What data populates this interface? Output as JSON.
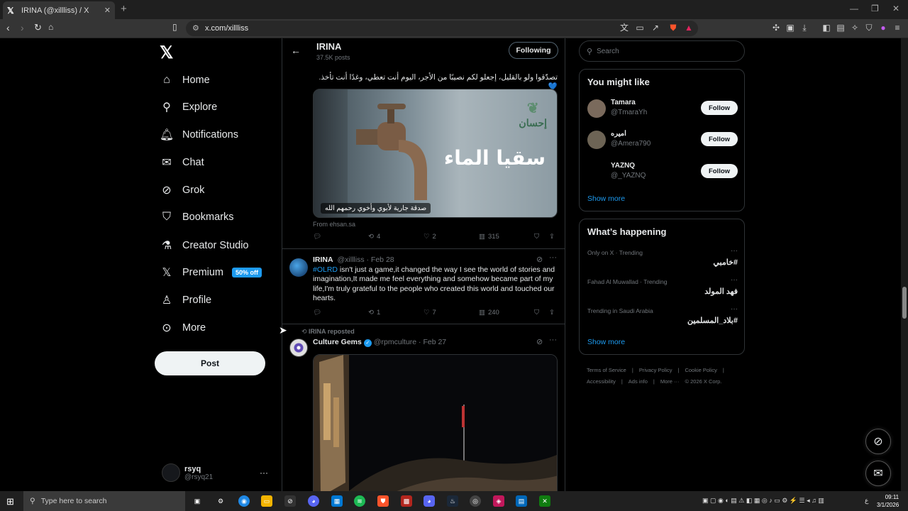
{
  "browser": {
    "tab_title": "IRINA (@xillliss) / X",
    "url": "x.com/xillliss",
    "new_tab": "+",
    "tab_close": "✕"
  },
  "nav": {
    "items": [
      {
        "label": "Home",
        "icon": "home-icon"
      },
      {
        "label": "Explore",
        "icon": "search-icon"
      },
      {
        "label": "Notifications",
        "icon": "bell-icon"
      },
      {
        "label": "Chat",
        "icon": "mail-icon"
      },
      {
        "label": "Grok",
        "icon": "grok-icon"
      },
      {
        "label": "Bookmarks",
        "icon": "bookmark-icon"
      },
      {
        "label": "Creator Studio",
        "icon": "flask-icon"
      },
      {
        "label": "Premium",
        "icon": "x-icon"
      },
      {
        "label": "Profile",
        "icon": "person-icon"
      },
      {
        "label": "More",
        "icon": "more-circle-icon"
      }
    ],
    "premium_badge": "50% off",
    "post_label": "Post",
    "user": {
      "name": "rsyq",
      "handle": "@rsyq21",
      "menu": "···"
    }
  },
  "header": {
    "name": "IRINA",
    "posts": "37.5K posts",
    "follow_label": "Following"
  },
  "tweet1": {
    "text": "تصدّقوا ولو بالقليل، إجعلو  لكم نصيبًا من الأجر، اليوم أنت تعطي، وغدًا أنت تأخذ.💙",
    "image_brand": "إحسان",
    "image_title": "سقيا الماء",
    "image_caption": "صدقة جارية لأبوي وأخوي رحمهم الله",
    "source": "From ehsan.sa",
    "reposts": "4",
    "likes": "2",
    "views": "315"
  },
  "tweet2": {
    "name": "IRINA",
    "handle": "@xillliss",
    "date": "· Feb 28",
    "tag": "#OLRD",
    "text": " isn't just a game,it changed the way I see the world of stories and imagination,It made me feel everything and somehow became part of my life,I'm truly grateful to the people who created this world and touched our hearts.",
    "reposts": "1",
    "likes": "7",
    "views": "240"
  },
  "tweet3": {
    "repost_label": "IRINA reposted",
    "name": "Culture Gems",
    "handle": "@rpmculture",
    "date": "· Feb 27"
  },
  "right": {
    "search_placeholder": "Search",
    "might_like_title": "You might like",
    "suggestions": [
      {
        "name": "Tamara",
        "handle": "@TmaraYh",
        "btn": "Follow"
      },
      {
        "name": "اميره",
        "handle": "@Amera790",
        "btn": "Follow"
      },
      {
        "name": "YAZNQ",
        "handle": "@_YAZNQ",
        "btn": "Follow"
      }
    ],
    "show_more": "Show more",
    "happening_title": "What’s happening",
    "trends": [
      {
        "context": "Only on X · Trending",
        "name": "#خامبي"
      },
      {
        "context": "Fahad Al Muwallad · Trending",
        "name": "فهد المولد"
      },
      {
        "context": "Trending in Saudi Arabia",
        "name": "#بلاد_المسلمين"
      }
    ],
    "footer": [
      "Terms of Service",
      "|",
      "Privacy Policy",
      "|",
      "Cookie Policy",
      "|",
      "Accessibility",
      "|",
      "Ads info",
      "|",
      "More ···",
      "© 2026 X Corp."
    ]
  },
  "taskbar": {
    "search_placeholder": "Type here to search",
    "time": "09:11",
    "date": "3/1/2026",
    "lang": "ع"
  }
}
